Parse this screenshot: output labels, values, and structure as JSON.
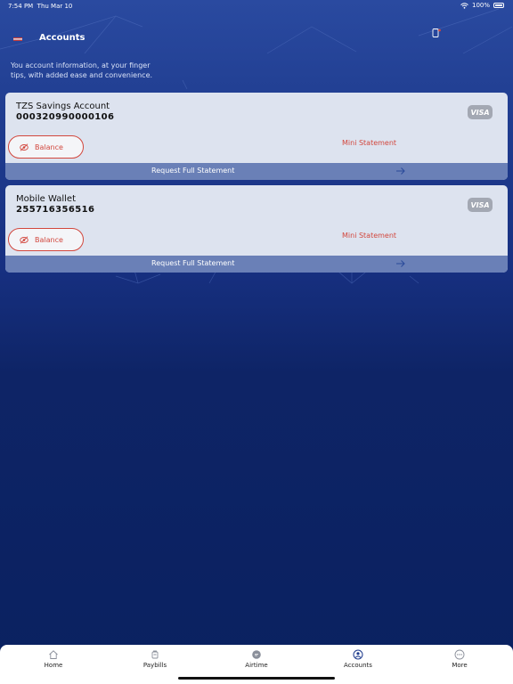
{
  "status_bar": {
    "time": "7:54 PM",
    "date": "Thu Mar 10",
    "battery": "100%"
  },
  "header": {
    "title": "Accounts"
  },
  "intro_text": "You account information, at your finger tips, with added ease and convenience.",
  "accounts": [
    {
      "name": "TZS Savings Account",
      "number": "000320990000106",
      "card_brand": "VISA",
      "balance_label": "Balance",
      "mini_statement_label": "Mini Statement",
      "full_statement_label": "Request Full Statement"
    },
    {
      "name": "Mobile Wallet",
      "number": "255716356516",
      "card_brand": "VISA",
      "balance_label": "Balance",
      "mini_statement_label": "Mini Statement",
      "full_statement_label": "Request Full Statement"
    }
  ],
  "tabs": [
    {
      "label": "Home",
      "icon": "home-icon"
    },
    {
      "label": "Paybills",
      "icon": "paybills-icon"
    },
    {
      "label": "Airtime",
      "icon": "airtime-icon"
    },
    {
      "label": "Accounts",
      "icon": "accounts-icon",
      "active": true
    },
    {
      "label": "More",
      "icon": "more-icon"
    }
  ],
  "colors": {
    "accent_red": "#d2473d",
    "card_bg": "#dde3ef",
    "statement_bar": "#6a80b7",
    "background": "#0a2260"
  }
}
